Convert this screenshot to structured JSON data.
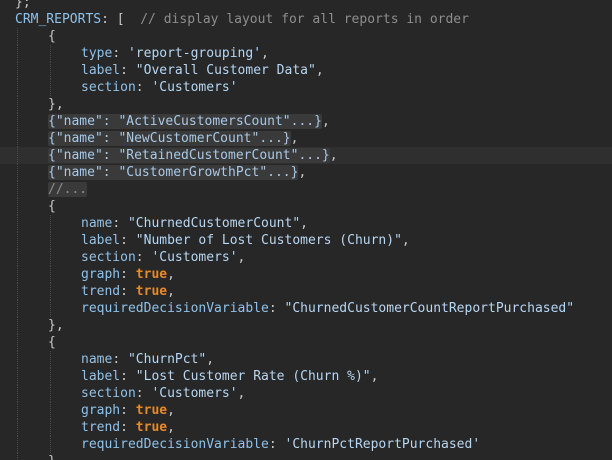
{
  "editor": {
    "theme": {
      "background": "#272727",
      "current_line": "#2f2f2f",
      "fold_bg": "#3a3a3a",
      "key": "#8ec2ea",
      "string": "#b7d6f2",
      "bool": "#e58a2a",
      "comment": "#8d8d8d"
    },
    "lines": [
      {
        "indent": 0,
        "tokens": [
          {
            "t": "punc",
            "v": "};"
          }
        ]
      },
      {
        "indent": 0,
        "tokens": [
          {
            "t": "const",
            "v": "CRM_REPORTS"
          },
          {
            "t": "punc",
            "v": ": [  "
          },
          {
            "t": "comment",
            "v": "// display layout for all reports in order"
          }
        ]
      },
      {
        "indent": 1,
        "tokens": [
          {
            "t": "punc",
            "v": "{"
          }
        ]
      },
      {
        "indent": 2,
        "tokens": [
          {
            "t": "key",
            "v": "type"
          },
          {
            "t": "punc",
            "v": ": "
          },
          {
            "t": "str",
            "v": "'report-grouping'"
          },
          {
            "t": "punc",
            "v": ","
          }
        ]
      },
      {
        "indent": 2,
        "tokens": [
          {
            "t": "key",
            "v": "label"
          },
          {
            "t": "punc",
            "v": ": "
          },
          {
            "t": "str",
            "v": "\"Overall Customer Data\""
          },
          {
            "t": "punc",
            "v": ","
          }
        ]
      },
      {
        "indent": 2,
        "tokens": [
          {
            "t": "key",
            "v": "section"
          },
          {
            "t": "punc",
            "v": ": "
          },
          {
            "t": "str",
            "v": "'Customers'"
          }
        ]
      },
      {
        "indent": 1,
        "tokens": [
          {
            "t": "punc",
            "v": "},"
          }
        ]
      },
      {
        "indent": 1,
        "tokens": [
          {
            "t": "json",
            "v": "{\"name\": \"ActiveCustomersCount\"...}",
            "fold": true
          },
          {
            "t": "punc",
            "v": ","
          }
        ]
      },
      {
        "indent": 1,
        "tokens": [
          {
            "t": "json",
            "v": "{\"name\": \"NewCustomerCount\"...}",
            "fold": true
          },
          {
            "t": "punc",
            "v": ","
          }
        ]
      },
      {
        "indent": 1,
        "current": true,
        "tokens": [
          {
            "t": "json",
            "v": "{\"name\": \"RetainedCustomerCount\"...}",
            "fold": true
          },
          {
            "t": "punc",
            "v": ","
          }
        ]
      },
      {
        "indent": 1,
        "tokens": [
          {
            "t": "json",
            "v": "{\"name\": \"CustomerGrowthPct\"...}",
            "fold": true
          },
          {
            "t": "punc",
            "v": ","
          }
        ]
      },
      {
        "indent": 1,
        "tokens": [
          {
            "t": "comment",
            "v": "//...",
            "fold": true
          }
        ]
      },
      {
        "indent": 1,
        "tokens": [
          {
            "t": "punc",
            "v": "{"
          }
        ]
      },
      {
        "indent": 2,
        "tokens": [
          {
            "t": "key",
            "v": "name"
          },
          {
            "t": "punc",
            "v": ": "
          },
          {
            "t": "str",
            "v": "\"ChurnedCustomerCount\""
          },
          {
            "t": "punc",
            "v": ","
          }
        ]
      },
      {
        "indent": 2,
        "tokens": [
          {
            "t": "key",
            "v": "label"
          },
          {
            "t": "punc",
            "v": ": "
          },
          {
            "t": "str",
            "v": "\"Number of Lost Customers (Churn)\""
          },
          {
            "t": "punc",
            "v": ","
          }
        ]
      },
      {
        "indent": 2,
        "tokens": [
          {
            "t": "key",
            "v": "section"
          },
          {
            "t": "punc",
            "v": ": "
          },
          {
            "t": "str",
            "v": "'Customers'"
          },
          {
            "t": "punc",
            "v": ","
          }
        ]
      },
      {
        "indent": 2,
        "tokens": [
          {
            "t": "key",
            "v": "graph"
          },
          {
            "t": "punc",
            "v": ": "
          },
          {
            "t": "bool",
            "v": "true"
          },
          {
            "t": "punc",
            "v": ","
          }
        ]
      },
      {
        "indent": 2,
        "tokens": [
          {
            "t": "key",
            "v": "trend"
          },
          {
            "t": "punc",
            "v": ": "
          },
          {
            "t": "bool",
            "v": "true"
          },
          {
            "t": "punc",
            "v": ","
          }
        ]
      },
      {
        "indent": 2,
        "tokens": [
          {
            "t": "key",
            "v": "requiredDecisionVariable"
          },
          {
            "t": "punc",
            "v": ": "
          },
          {
            "t": "str",
            "v": "\"ChurnedCustomerCountReportPurchased\""
          }
        ]
      },
      {
        "indent": 1,
        "tokens": [
          {
            "t": "punc",
            "v": "},"
          }
        ]
      },
      {
        "indent": 1,
        "tokens": [
          {
            "t": "punc",
            "v": "{"
          }
        ]
      },
      {
        "indent": 2,
        "tokens": [
          {
            "t": "key",
            "v": "name"
          },
          {
            "t": "punc",
            "v": ": "
          },
          {
            "t": "str",
            "v": "\"ChurnPct\""
          },
          {
            "t": "punc",
            "v": ","
          }
        ]
      },
      {
        "indent": 2,
        "tokens": [
          {
            "t": "key",
            "v": "label"
          },
          {
            "t": "punc",
            "v": ": "
          },
          {
            "t": "str",
            "v": "\"Lost Customer Rate (Churn %)\""
          },
          {
            "t": "punc",
            "v": ","
          }
        ]
      },
      {
        "indent": 2,
        "tokens": [
          {
            "t": "key",
            "v": "section"
          },
          {
            "t": "punc",
            "v": ": "
          },
          {
            "t": "str",
            "v": "'Customers'"
          },
          {
            "t": "punc",
            "v": ","
          }
        ]
      },
      {
        "indent": 2,
        "tokens": [
          {
            "t": "key",
            "v": "graph"
          },
          {
            "t": "punc",
            "v": ": "
          },
          {
            "t": "bool",
            "v": "true"
          },
          {
            "t": "punc",
            "v": ","
          }
        ]
      },
      {
        "indent": 2,
        "tokens": [
          {
            "t": "key",
            "v": "trend"
          },
          {
            "t": "punc",
            "v": ": "
          },
          {
            "t": "bool",
            "v": "true"
          },
          {
            "t": "punc",
            "v": ","
          }
        ]
      },
      {
        "indent": 2,
        "tokens": [
          {
            "t": "key",
            "v": "requiredDecisionVariable"
          },
          {
            "t": "punc",
            "v": ": "
          },
          {
            "t": "str",
            "v": "'ChurnPctReportPurchased'"
          }
        ]
      },
      {
        "indent": 1,
        "tokens": [
          {
            "t": "punc",
            "v": "},"
          }
        ]
      }
    ]
  }
}
